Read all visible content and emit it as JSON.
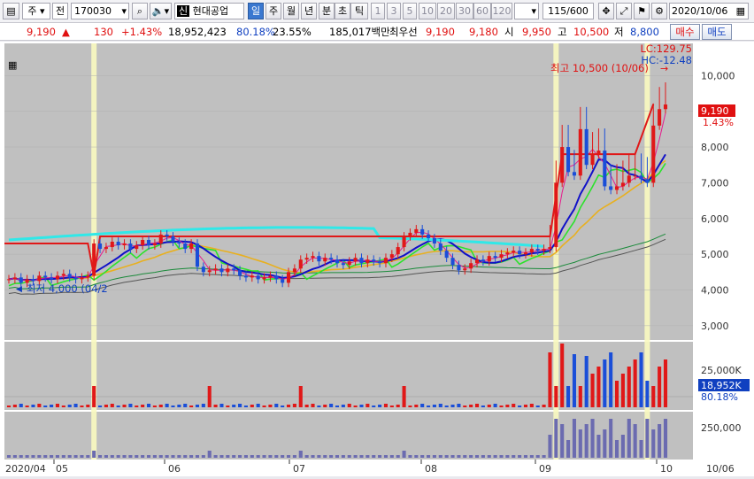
{
  "toolbar": {
    "market": "주",
    "type": "전",
    "code": "170030",
    "name": "현대공업",
    "badge": "신",
    "periods": [
      "일",
      "주",
      "월",
      "년",
      "분",
      "초",
      "틱"
    ],
    "active_period": "일",
    "intervals": [
      "1",
      "3",
      "5",
      "10",
      "20",
      "30",
      "60",
      "120"
    ],
    "count": "115/600",
    "date": "2020/10/06"
  },
  "info": {
    "price": "9,190",
    "change": "130",
    "change_pct": "+1.43%",
    "volume": "18,952,423",
    "vol_ratio": "80.18%",
    "turnover": "23.55%",
    "amount": "185,017백만",
    "best_label": "최우선",
    "ask": "9,190",
    "bid": "9,180",
    "open_label": "시",
    "open": "9,950",
    "high_label": "고",
    "high": "10,500",
    "low_label": "저",
    "low": "8,800",
    "buy_label": "매수",
    "sell_label": "매도"
  },
  "chart_labels": {
    "lc": "LC:129.75",
    "hc": "HC:-12.48",
    "high_note": "최고 10,500 (10/06)",
    "low_note": "최저 4,000 (04/2",
    "price_tag": "9,190",
    "price_pct": "1.43%",
    "vol_tag": "18,952K",
    "vol_pct": "80.18%",
    "vol_tick": "25,000K",
    "amt_tick": "250,000",
    "y_ticks": [
      "10,000",
      "9,000",
      "8,000",
      "7,000",
      "6,000",
      "5,000",
      "4,000",
      "3,000"
    ],
    "x_ticks": [
      "2020/04",
      "05",
      "06",
      "07",
      "08",
      "09",
      "10",
      "10/06"
    ]
  },
  "chart_data": {
    "type": "candlestick",
    "x_range": [
      "2020/04",
      "2020/10/06"
    ],
    "ylim": [
      2600,
      10900
    ],
    "series": [
      {
        "name": "close",
        "values": [
          4300,
          4350,
          4200,
          4300,
          4250,
          4400,
          4350,
          4300,
          4400,
          4450,
          4350,
          4300,
          4350,
          4400,
          5300,
          5150,
          5200,
          5350,
          5250,
          5300,
          5150,
          5250,
          5400,
          5250,
          5300,
          5550,
          5500,
          5350,
          5300,
          5150,
          5300,
          4650,
          4500,
          4550,
          4600,
          4500,
          4600,
          4550,
          4400,
          4350,
          4400,
          4300,
          4350,
          4400,
          4300,
          4200,
          4500,
          4600,
          4850,
          4900,
          4950,
          4800,
          4900,
          4850,
          4750,
          4700,
          4800,
          4900,
          4750,
          4850,
          4800,
          4750,
          4900,
          5000,
          5200,
          5500,
          5600,
          5700,
          5550,
          5450,
          5300,
          5100,
          4900,
          4700,
          4550,
          4600,
          4750,
          4850,
          4800,
          4950,
          4900,
          5000,
          5050,
          5100,
          5000,
          5050,
          5150,
          5100,
          5150,
          5200,
          7000,
          8000,
          7300,
          7200,
          8500,
          7500,
          7800,
          7900,
          6900,
          6800,
          6900,
          7000,
          7200,
          7200,
          7100,
          7000,
          8600,
          9060,
          9190
        ]
      },
      {
        "name": "MA5",
        "values": []
      },
      {
        "name": "MA20",
        "values": []
      }
    ]
  },
  "colors": {
    "up": "#e01818",
    "down": "#1a4ed8",
    "ma_short": "#e61a8c",
    "ma_mid": "#1010c8",
    "ma_long": "#e8b020",
    "envelope": "#2ce22c",
    "cloud": "#30e8e8",
    "resistance": "#e01818",
    "highlight": "#fafac0"
  }
}
